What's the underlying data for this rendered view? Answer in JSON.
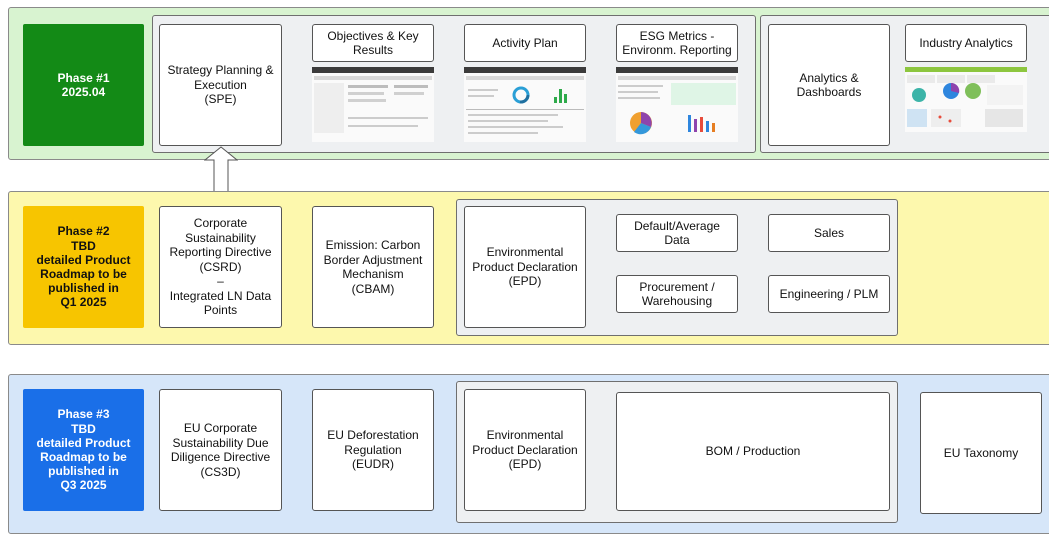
{
  "colors": {
    "phase1_fill": "#138a16",
    "phase1_band": "#d8f3d0",
    "phase2_fill": "#f7c500",
    "phase2_band": "#fdf8ad",
    "phase3_fill": "#1a6fe8",
    "phase3_band": "#d6e6f9",
    "group_fill": "#eef0f2"
  },
  "phase1": {
    "label": "Phase #1\n2025.04",
    "items": {
      "spe": "Strategy Planning &\nExecution\n(SPE)",
      "okr": "Objectives & Key\nResults",
      "activity_plan": "Activity Plan",
      "esg_metrics": "ESG Metrics -\nEnvironm. Reporting",
      "analytics_dashboards": "Analytics &\nDashboards",
      "industry_analytics": "Industry Analytics"
    }
  },
  "phase2": {
    "label": "Phase #2\nTBD\ndetailed Product\nRoadmap to be\npublished in\nQ1 2025",
    "items": {
      "csrd": "Corporate\nSustainability\nReporting Directive\n(CSRD)\n–\nIntegrated LN Data\nPoints",
      "cbam": "Emission: Carbon\nBorder Adjustment\nMechanism\n(CBAM)",
      "epd": "Environmental\nProduct Declaration\n(EPD)",
      "default_average": "Default/Average\nData",
      "sales": "Sales",
      "procurement": "Procurement /\nWarehousing",
      "engineering": "Engineering / PLM"
    }
  },
  "phase3": {
    "label": "Phase #3\nTBD\ndetailed Product\nRoadmap to be\npublished in\nQ3 2025",
    "items": {
      "cs3d": "EU Corporate\nSustainability Due\nDiligence Directive\n(CS3D)",
      "eudr": "EU Deforestation\nRegulation\n(EUDR)",
      "epd": "Environmental\nProduct Declaration\n(EPD)",
      "bom_production": "BOM / Production",
      "eu_taxonomy": "EU Taxonomy"
    }
  }
}
